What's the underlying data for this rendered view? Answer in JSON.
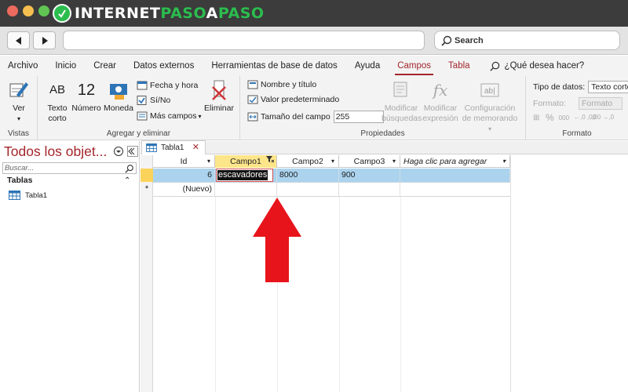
{
  "site": {
    "logo_prefix": "INTERNET",
    "logo_highlight": "PASO",
    "logo_mid": "A",
    "logo_suffix": "PASO"
  },
  "browser": {
    "search_placeholder": "Search"
  },
  "ribbon_tabs": [
    "Archivo",
    "Inicio",
    "Crear",
    "Datos externos",
    "Herramientas de base de datos",
    "Ayuda",
    "Campos",
    "Tabla"
  ],
  "active_tab": "Campos",
  "tell_me": "¿Qué desea hacer?",
  "ribbon": {
    "vistas": {
      "ver": "Ver",
      "label": "Vistas"
    },
    "agregar": {
      "texto_corto": "Texto corto",
      "numero": "Número",
      "moneda": "Moneda",
      "fecha_hora": "Fecha y hora",
      "si_no": "Sí/No",
      "mas_campos": "Más campos",
      "eliminar": "Eliminar",
      "label": "Agregar y eliminar",
      "icon_ab": "AB",
      "icon_12": "12"
    },
    "propiedades": {
      "nombre_titulo": "Nombre y título",
      "valor_predeterminado": "Valor predeterminado",
      "tamano_campo": "Tamaño del campo",
      "tamano_valor": "255",
      "modificar_busquedas": "Modificar búsquedas",
      "modificar_expresion": "Modificar expresión",
      "config_memorando": "Configuración de memorando",
      "label": "Propiedades"
    },
    "formato": {
      "tipo_datos_label": "Tipo de datos:",
      "tipo_datos_valor": "Texto corto",
      "formato_label": "Formato:",
      "formato_valor": "Formato",
      "percent": "%",
      "thousands": "000",
      "inc_dec": "←,0 ,00",
      "dec_dec": ",00 →,0",
      "label": "Formato"
    }
  },
  "nav_pane": {
    "title": "Todos los objet...",
    "search_placeholder": "Buscar...",
    "section": "Tablas",
    "items": [
      "Tabla1"
    ]
  },
  "document": {
    "tab_label": "Tabla1",
    "columns": [
      "Id",
      "Campo1",
      "Campo2",
      "Campo3",
      "Haga clic para agregar"
    ],
    "rows": [
      {
        "id": "6",
        "campo1": "escavadores",
        "campo2": "8000",
        "campo3": "900"
      }
    ],
    "new_row_marker": "*",
    "new_row_label": "(Nuevo)"
  },
  "colors": {
    "accent": "#a4262c",
    "row_selected": "#abd3ee",
    "active_header": "#fde58a",
    "arrow": "#e8141c"
  }
}
